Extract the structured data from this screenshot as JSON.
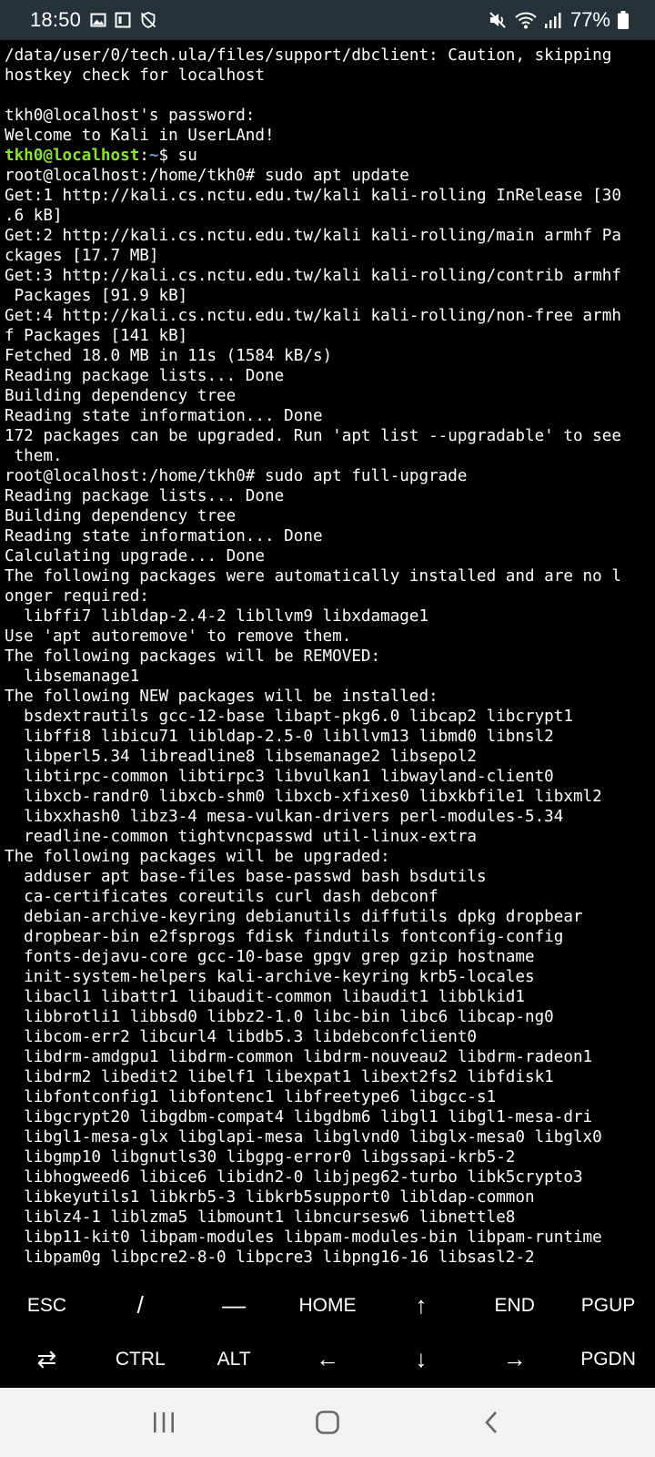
{
  "status_bar": {
    "time": "18:50",
    "battery": "77%",
    "icons": [
      "gallery-icon",
      "screen-icon",
      "shield-off-icon",
      "mute-icon",
      "wifi-icon",
      "signal-icon",
      "battery-icon"
    ]
  },
  "terminal": {
    "lines": [
      "/data/user/0/tech.ula/files/support/dbclient: Caution, skipping",
      "hostkey check for localhost",
      "",
      "tkh0@localhost's password:",
      "Welcome to Kali in UserLAnd!",
      "",
      "root@localhost:/home/tkh0# sudo apt update",
      "Get:1 http://kali.cs.nctu.edu.tw/kali kali-rolling InRelease [30",
      ".6 kB]",
      "Get:2 http://kali.cs.nctu.edu.tw/kali kali-rolling/main armhf Pa",
      "ckages [17.7 MB]",
      "Get:3 http://kali.cs.nctu.edu.tw/kali kali-rolling/contrib armhf",
      " Packages [91.9 kB]",
      "Get:4 http://kali.cs.nctu.edu.tw/kali kali-rolling/non-free armh",
      "f Packages [141 kB]",
      "Fetched 18.0 MB in 11s (1584 kB/s)",
      "Reading package lists... Done",
      "Building dependency tree",
      "Reading state information... Done",
      "172 packages can be upgraded. Run 'apt list --upgradable' to see",
      " them.",
      "root@localhost:/home/tkh0# sudo apt full-upgrade",
      "Reading package lists... Done",
      "Building dependency tree",
      "Reading state information... Done",
      "Calculating upgrade... Done",
      "The following packages were automatically installed and are no l",
      "onger required:",
      "  libffi7 libldap-2.4-2 libllvm9 libxdamage1",
      "Use 'apt autoremove' to remove them.",
      "The following packages will be REMOVED:",
      "  libsemanage1",
      "The following NEW packages will be installed:",
      "  bsdextrautils gcc-12-base libapt-pkg6.0 libcap2 libcrypt1",
      "  libffi8 libicu71 libldap-2.5-0 libllvm13 libmd0 libnsl2",
      "  libperl5.34 libreadline8 libsemanage2 libsepol2",
      "  libtirpc-common libtirpc3 libvulkan1 libwayland-client0",
      "  libxcb-randr0 libxcb-shm0 libxcb-xfixes0 libxkbfile1 libxml2",
      "  libxxhash0 libz3-4 mesa-vulkan-drivers perl-modules-5.34",
      "  readline-common tightvncpasswd util-linux-extra",
      "The following packages will be upgraded:",
      "  adduser apt base-files base-passwd bash bsdutils",
      "  ca-certificates coreutils curl dash debconf",
      "  debian-archive-keyring debianutils diffutils dpkg dropbear",
      "  dropbear-bin e2fsprogs fdisk findutils fontconfig-config",
      "  fonts-dejavu-core gcc-10-base gpgv grep gzip hostname",
      "  init-system-helpers kali-archive-keyring krb5-locales",
      "  libacl1 libattr1 libaudit-common libaudit1 libblkid1",
      "  libbrotli1 libbsd0 libbz2-1.0 libc-bin libc6 libcap-ng0",
      "  libcom-err2 libcurl4 libdb5.3 libdebconfclient0",
      "  libdrm-amdgpu1 libdrm-common libdrm-nouveau2 libdrm-radeon1",
      "  libdrm2 libedit2 libelf1 libexpat1 libext2fs2 libfdisk1",
      "  libfontconfig1 libfontenc1 libfreetype6 libgcc-s1",
      "  libgcrypt20 libgdbm-compat4 libgdbm6 libgl1 libgl1-mesa-dri",
      "  libgl1-mesa-glx libglapi-mesa libglvnd0 libglx-mesa0 libglx0",
      "  libgmp10 libgnutls30 libgpg-error0 libgssapi-krb5-2",
      "  libhogweed6 libice6 libidn2-0 libjpeg62-turbo libk5crypto3",
      "  libkeyutils1 libkrb5-3 libkrb5support0 libldap-common",
      "  liblz4-1 liblzma5 libmount1 libncursesw6 libnettle8",
      "  libp11-kit0 libpam-modules libpam-modules-bin libpam-runtime",
      "  libpam0g libpcre2-8-0 libpcre3 libpng16-16 libsasl2-2"
    ],
    "prompt": {
      "user_host": "tkh0@localhost",
      "sep": ":",
      "path": "~",
      "symbol": "$",
      "command": " su"
    },
    "colors": {
      "user_host": "#8ae234",
      "path": "#729fcf"
    }
  },
  "extra_keys": {
    "row1": [
      "ESC",
      "/",
      "—",
      "HOME",
      "↑",
      "END",
      "PGUP"
    ],
    "row2": [
      "⇄",
      "CTRL",
      "ALT",
      "←",
      "↓",
      "→",
      "PGDN"
    ]
  },
  "nav_bar": {
    "buttons": [
      "recent-apps",
      "home",
      "back"
    ]
  }
}
